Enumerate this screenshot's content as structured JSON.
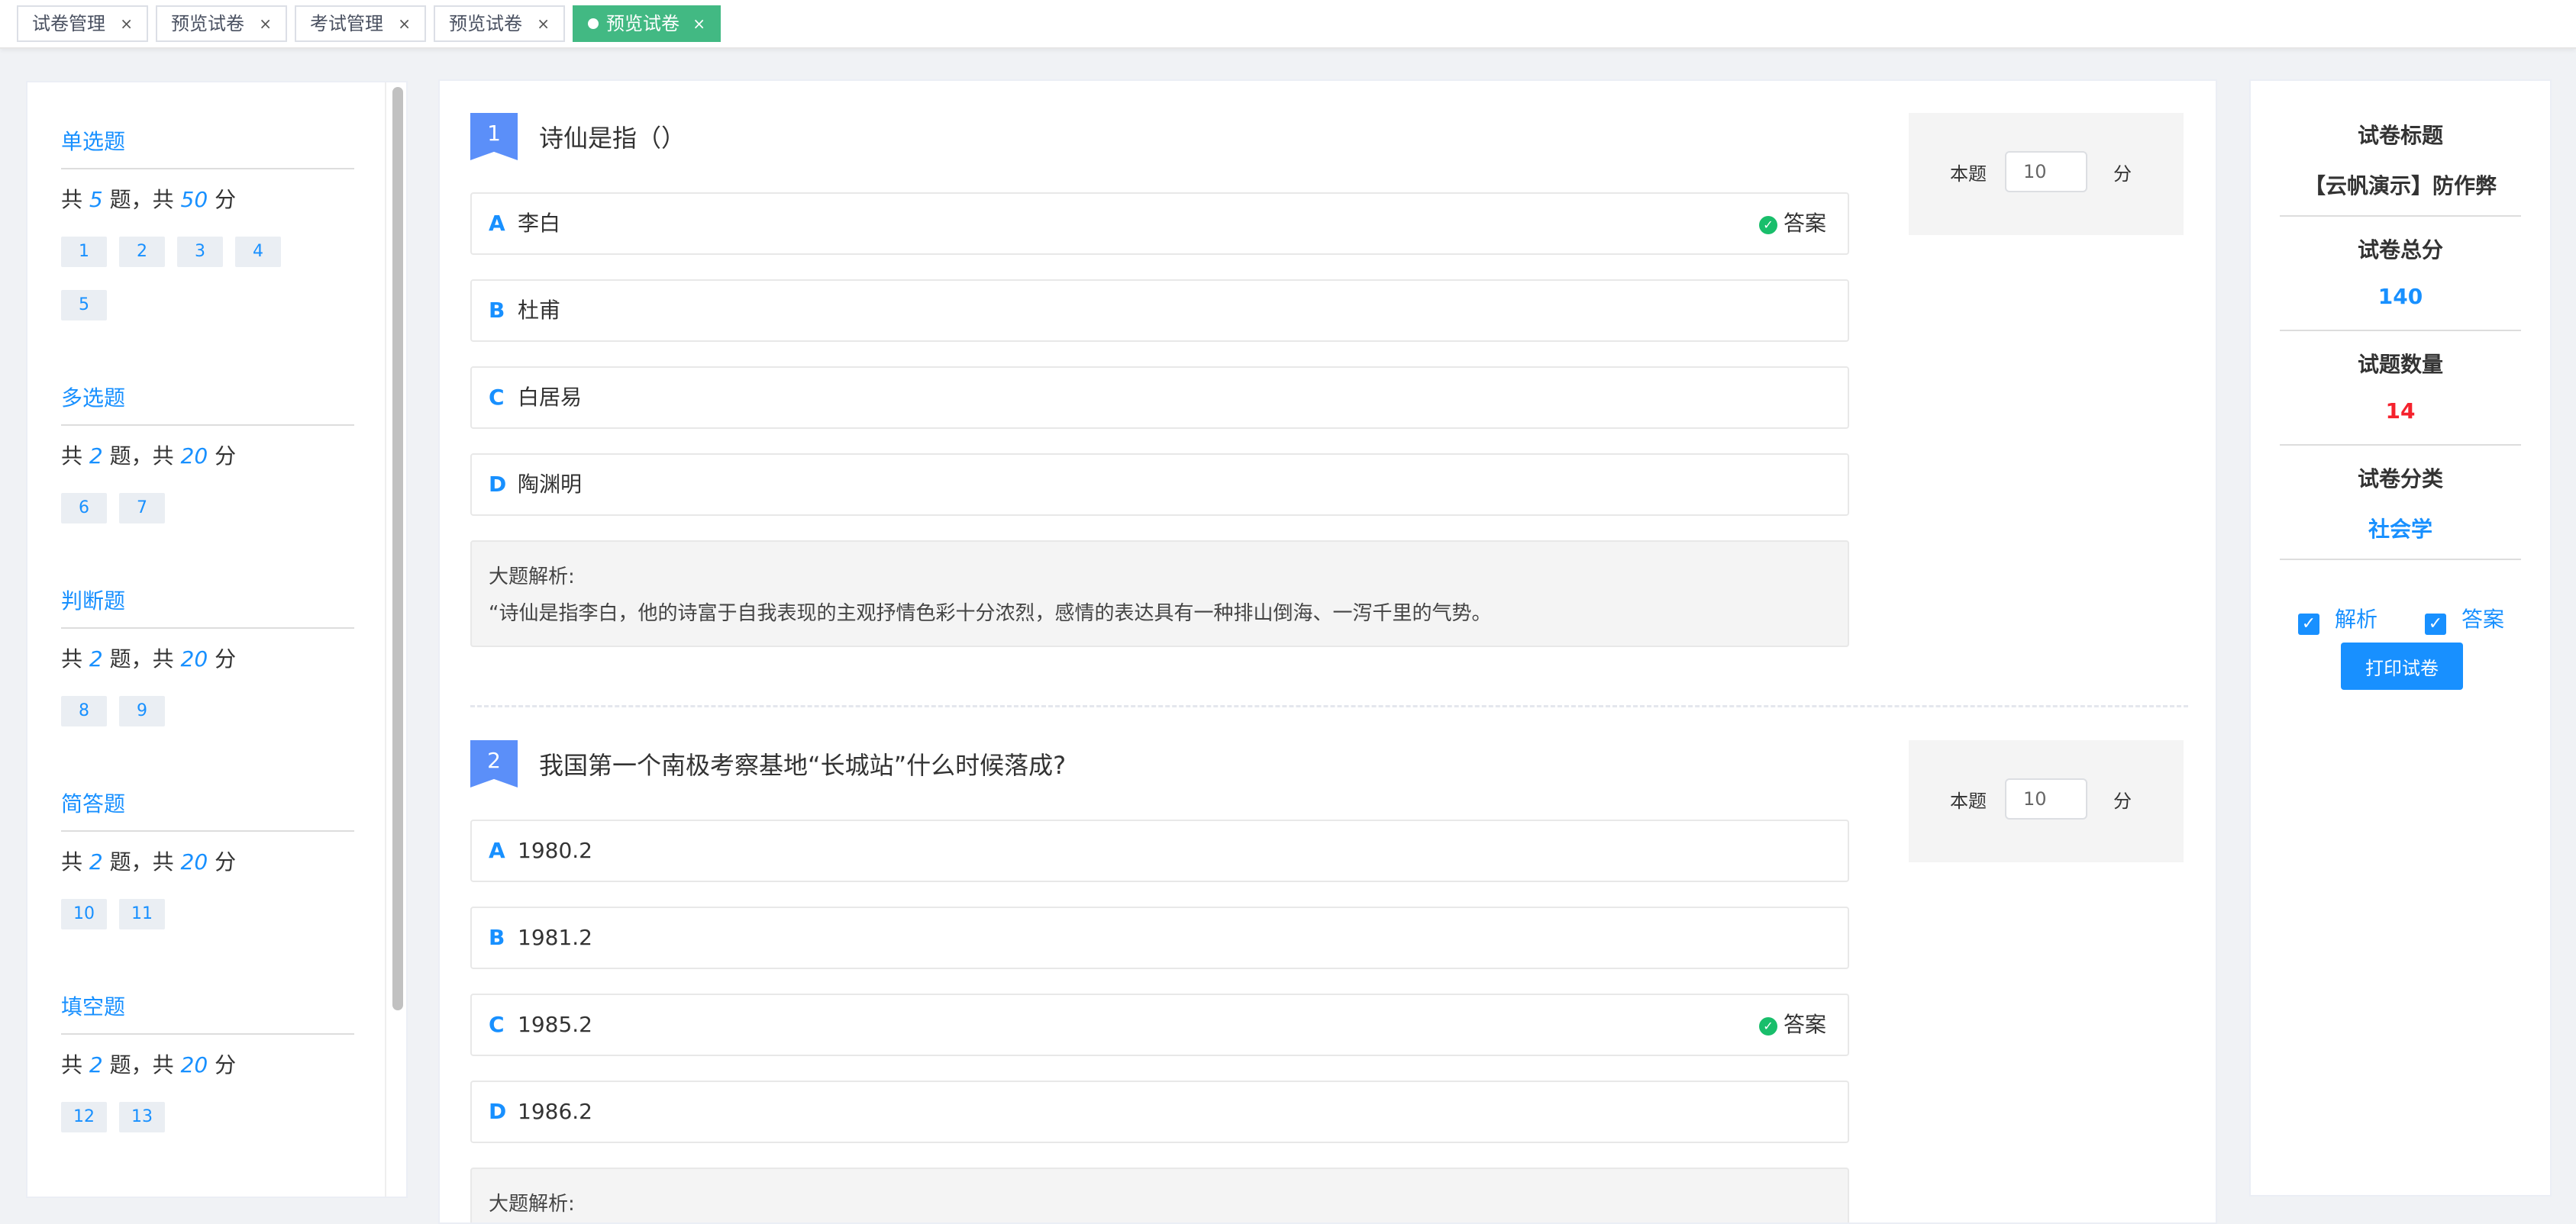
{
  "tabs": [
    {
      "label": "试卷管理"
    },
    {
      "label": "预览试卷"
    },
    {
      "label": "考试管理"
    },
    {
      "label": "预览试卷"
    },
    {
      "label": "预览试卷",
      "active": true
    }
  ],
  "close_glyph": "×",
  "sidebar": {
    "groups": [
      {
        "title": "单选题",
        "prefix": "共 ",
        "count": "5",
        "mid": " 题，共 ",
        "score": "50",
        "suffix": " 分",
        "items": [
          "1",
          "2",
          "3",
          "4",
          "5"
        ]
      },
      {
        "title": "多选题",
        "prefix": "共 ",
        "count": "2",
        "mid": " 题，共 ",
        "score": "20",
        "suffix": " 分",
        "items": [
          "6",
          "7"
        ]
      },
      {
        "title": "判断题",
        "prefix": "共 ",
        "count": "2",
        "mid": " 题，共 ",
        "score": "20",
        "suffix": " 分",
        "items": [
          "8",
          "9"
        ]
      },
      {
        "title": "简答题",
        "prefix": "共 ",
        "count": "2",
        "mid": " 题，共 ",
        "score": "20",
        "suffix": " 分",
        "items": [
          "10",
          "11"
        ]
      },
      {
        "title": "填空题",
        "prefix": "共 ",
        "count": "2",
        "mid": " 题，共 ",
        "score": "20",
        "suffix": " 分",
        "items": [
          "12",
          "13"
        ]
      }
    ]
  },
  "questions": [
    {
      "number": "1",
      "title": "诗仙是指（）",
      "options": [
        {
          "letter": "A",
          "text": "李白",
          "answer": true
        },
        {
          "letter": "B",
          "text": "杜甫"
        },
        {
          "letter": "C",
          "text": "白居易"
        },
        {
          "letter": "D",
          "text": "陶渊明"
        }
      ],
      "analysis_label": "大题解析:",
      "analysis_text": "“诗仙是指李白，他的诗富于自我表现的主观抒情色彩十分浓烈，感情的表达具有一种排山倒海、一泻千里的气势。",
      "score_label": "本题",
      "score_value": "10",
      "score_unit": "分"
    },
    {
      "number": "2",
      "title": "我国第一个南极考察基地“长城站”什么时候落成?",
      "options": [
        {
          "letter": "A",
          "text": "1980.2"
        },
        {
          "letter": "B",
          "text": "1981.2"
        },
        {
          "letter": "C",
          "text": "1985.2",
          "answer": true
        },
        {
          "letter": "D",
          "text": "1986.2"
        }
      ],
      "analysis_label": "大题解析:",
      "score_label": "本题",
      "score_value": "10",
      "score_unit": "分"
    }
  ],
  "answer_label": "答案",
  "check_glyph": "✓",
  "info": {
    "title_label": "试卷标题",
    "title_value": "【云帆演示】防作弊",
    "total_label": "试卷总分",
    "total_value": "140",
    "count_label": "试题数量",
    "count_value": "14",
    "category_label": "试卷分类",
    "category_value": "社会学",
    "show_analysis_label": "解析",
    "show_answer_label": "答案",
    "print_label": "打印试卷"
  },
  "colors": {
    "accent": "#1890ff",
    "active_tab": "#42b983",
    "danger": "#f5222d",
    "correct": "#19be6b",
    "question_badge": "#5b8ff9"
  }
}
